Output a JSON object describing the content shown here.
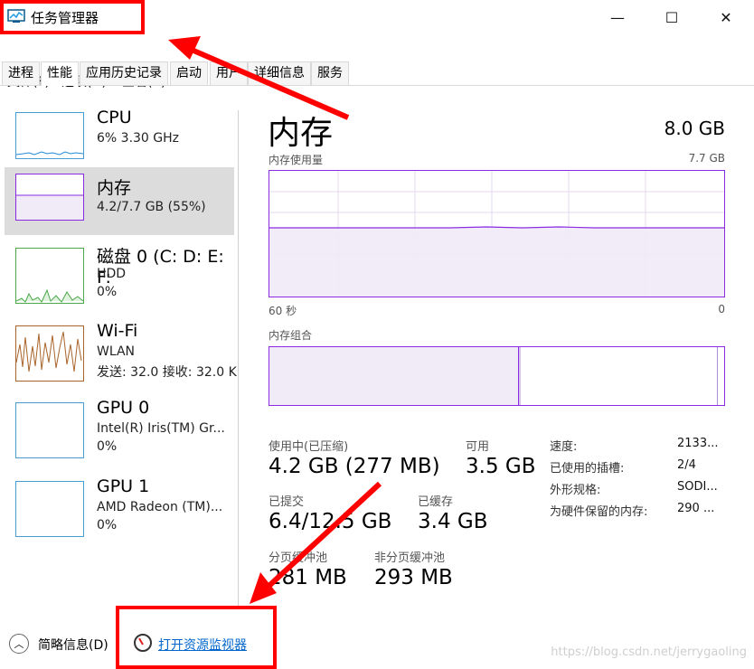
{
  "window": {
    "title": "任务管理器",
    "controls": {
      "minimize": "—",
      "maximize": "☐",
      "close": "✕"
    }
  },
  "menu": [
    "文件(F)",
    "选项(O)",
    "查看(V)"
  ],
  "tabs": [
    "进程",
    "性能",
    "应用历史记录",
    "启动",
    "用户",
    "详细信息",
    "服务"
  ],
  "resources": [
    {
      "name": "CPU",
      "sub1": "6% 3.30 GHz",
      "sub2": "",
      "sub3": ""
    },
    {
      "name": "内存",
      "sub1": "4.2/7.7 GB (55%)",
      "sub2": "",
      "sub3": ""
    },
    {
      "name": "磁盘 0 (C: D: E: F:",
      "sub1": "HDD",
      "sub2": "0%",
      "sub3": ""
    },
    {
      "name": "Wi-Fi",
      "sub1": "WLAN",
      "sub2": "发送: 32.0 接收: 32.0 K",
      "sub3": ""
    },
    {
      "name": "GPU 0",
      "sub1": "Intel(R) Iris(TM) Gr...",
      "sub2": "0%",
      "sub3": ""
    },
    {
      "name": "GPU 1",
      "sub1": "AMD Radeon (TM)...",
      "sub2": "0%",
      "sub3": ""
    }
  ],
  "main": {
    "title": "内存",
    "total": "8.0 GB",
    "usage_label": "内存使用量",
    "usage_max": "7.7 GB",
    "x_left": "60 秒",
    "x_right": "0",
    "composition_label": "内存组合"
  },
  "stats": {
    "in_use_label": "使用中(已压缩)",
    "in_use_value": "4.2 GB (277 MB)",
    "available_label": "可用",
    "available_value": "3.5 GB",
    "committed_label": "已提交",
    "committed_value": "6.4/12.5 GB",
    "cached_label": "已缓存",
    "cached_value": "3.4 GB",
    "paged_label": "分页缓冲池",
    "paged_value": "281 MB",
    "nonpaged_label": "非分页缓冲池",
    "nonpaged_value": "293 MB"
  },
  "details": [
    {
      "label": "速度:",
      "value": "2133..."
    },
    {
      "label": "已使用的插槽:",
      "value": "2/4"
    },
    {
      "label": "外形规格:",
      "value": "SODI..."
    },
    {
      "label": "为硬件保留的内存:",
      "value": "290 ..."
    }
  ],
  "bottom": {
    "summary": "简略信息(D)",
    "open_monitor": "打开资源监视器"
  },
  "watermark": "https://blog.csdn.net/jerrygaoling",
  "colors": {
    "accent": "#8a2be2",
    "selected": "#cce4f7",
    "annotation": "#ff0000"
  }
}
